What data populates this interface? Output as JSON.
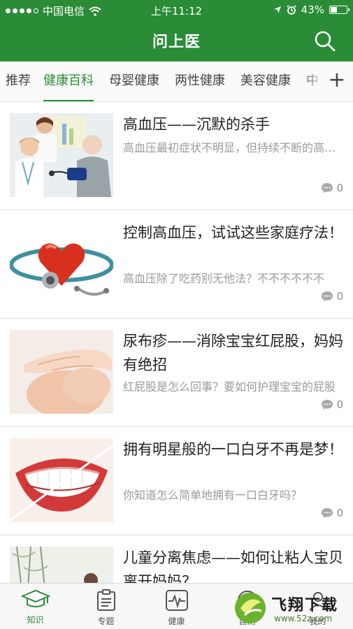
{
  "status_bar": {
    "carrier": "中国电信",
    "time": "上午11:12",
    "battery": "43%",
    "battery_level": 0.43
  },
  "header": {
    "title": "问上医",
    "search_icon": "search-icon"
  },
  "category_tabs": {
    "items": [
      {
        "label": "推荐",
        "active": false
      },
      {
        "label": "健康百科",
        "active": true
      },
      {
        "label": "母婴健康",
        "active": false
      },
      {
        "label": "两性健康",
        "active": false
      },
      {
        "label": "美容健康",
        "active": false
      },
      {
        "label": "中",
        "active": false
      }
    ],
    "add_label": "+"
  },
  "articles": [
    {
      "title": "高血压——沉默的杀手",
      "desc": "高血压最初症状不明显，但持续不断的高血压",
      "comments": "0",
      "image": "doctor-measuring-blood-pressure"
    },
    {
      "title": "控制高血压，试试这些家庭疗法！",
      "desc": "高血压除了吃药别无他法？不不不不不不",
      "comments": "0",
      "image": "heart-with-stethoscope"
    },
    {
      "title": "尿布疹——消除宝宝红屁股，妈妈有绝招",
      "desc": "红屁股是怎么回事？要如何护理宝宝的屁股",
      "comments": "0",
      "image": "baby-skin-care"
    },
    {
      "title": "拥有明星般的一口白牙不再是梦！",
      "desc": "你知道怎么简单地拥有一口白牙吗？",
      "comments": "0",
      "image": "white-teeth-smile"
    },
    {
      "title": "儿童分离焦虑——如何让粘人宝贝离开妈妈？",
      "desc": "",
      "comments": "",
      "image": "child-outdoors"
    }
  ],
  "bottom_tabs": [
    {
      "label": "知识",
      "icon": "graduation-cap-icon",
      "active": true
    },
    {
      "label": "专题",
      "icon": "clipboard-icon",
      "active": false
    },
    {
      "label": "健康",
      "icon": "heartbeat-icon",
      "active": false
    },
    {
      "label": "自测",
      "icon": "self-test-icon",
      "active": false
    },
    {
      "label": "我的",
      "icon": "profile-icon",
      "active": false
    }
  ],
  "watermark": {
    "title": "飞翔下载",
    "url": "www.52z.com"
  },
  "colors": {
    "brand_green": "#2a8c36",
    "text_gray": "#9a9a9a"
  }
}
